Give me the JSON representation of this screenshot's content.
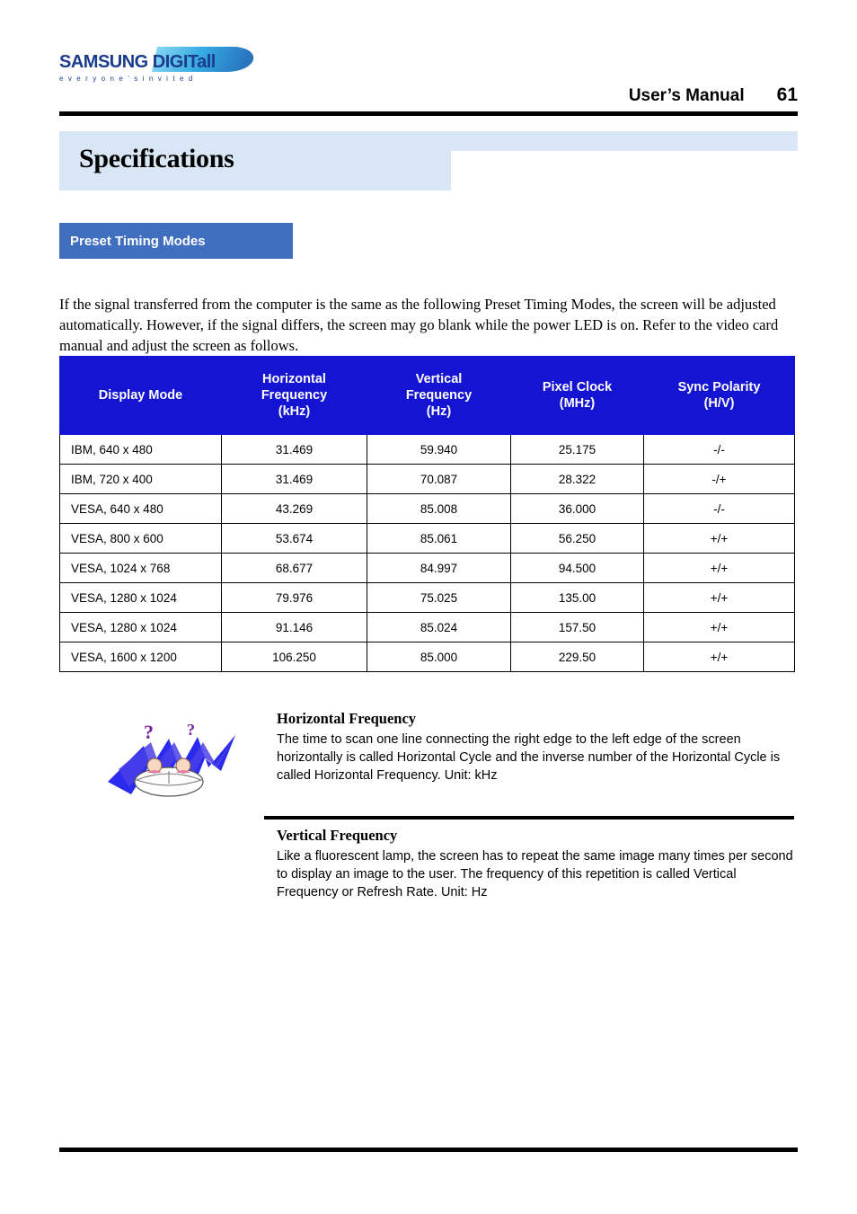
{
  "header": {
    "logo_main": "SAMSUNG DIGITall",
    "logo_sub": "e v e r y o n e ' s   i n v i t e d",
    "manual_label": "User’s Manual",
    "page_number": "61"
  },
  "title": "Specifications",
  "section": {
    "label": "Preset Timing Modes"
  },
  "intro": "If the signal transferred from the computer is the same as the following Preset Timing Modes, the screen will be adjusted automatically. However, if the signal differs, the screen may go blank while the power LED is on. Refer to the video card manual and adjust the screen as follows.",
  "table": {
    "headers": [
      "Display Mode",
      "Horizontal\nFrequency\n(kHz)",
      "Vertical\nFrequency\n(Hz)",
      "Pixel Clock\n(MHz)",
      "Sync Polarity\n(H/V)"
    ],
    "header_lines": {
      "c0": [
        "Display Mode"
      ],
      "c1": [
        "Horizontal",
        "Frequency",
        "(kHz)"
      ],
      "c2": [
        "Vertical",
        "Frequency",
        "(Hz)"
      ],
      "c3": [
        "Pixel Clock",
        "(MHz)"
      ],
      "c4": [
        "Sync Polarity",
        "(H/V)"
      ]
    },
    "rows": [
      [
        "IBM, 640 x 480",
        "31.469",
        "59.940",
        "25.175",
        "-/-"
      ],
      [
        "IBM, 720 x 400",
        "31.469",
        "70.087",
        "28.322",
        "-/+"
      ],
      [
        "VESA, 640 x 480",
        "43.269",
        "85.008",
        "36.000",
        "-/-"
      ],
      [
        "VESA, 800 x 600",
        "53.674",
        "85.061",
        "56.250",
        "+/+"
      ],
      [
        "VESA, 1024 x 768",
        "68.677",
        "84.997",
        "94.500",
        "+/+"
      ],
      [
        "VESA, 1280 x 1024",
        "79.976",
        "75.025",
        "135.00",
        "+/+"
      ],
      [
        "VESA, 1280 x 1024",
        "91.146",
        "85.024",
        "157.50",
        "+/+"
      ],
      [
        "VESA, 1600 x 1200",
        "106.250",
        "85.000",
        "229.50",
        "+/+"
      ]
    ]
  },
  "notes": [
    {
      "title": "Horizontal Frequency",
      "body": "The time to scan one line connecting the right edge to the left edge of the screen horizontally is called Horizontal Cycle and the inverse number of the Horizontal Cycle is called Horizontal Frequency. Unit: kHz"
    },
    {
      "title": "Vertical Frequency",
      "body": "Like a fluorescent lamp, the screen has to repeat the same image many times per second to display an image to the user. The frequency of this repetition is called Vertical Frequency or Refresh Rate. Unit: Hz"
    }
  ],
  "colors": {
    "header_blue": "#1414d2",
    "chip_blue": "#3f6fbe",
    "band_blue": "#d9e6f5",
    "logo_blue": "#1b3c8c"
  }
}
